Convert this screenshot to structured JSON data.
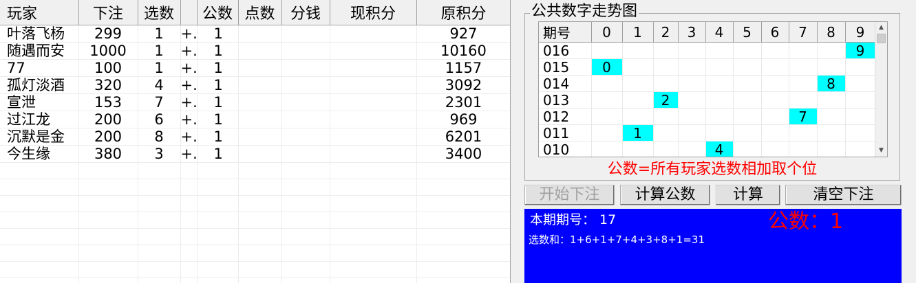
{
  "grid": {
    "columns": [
      "玩家",
      "下注",
      "选数",
      "",
      "公数",
      "点数",
      "分钱",
      "现积分",
      "原积分"
    ],
    "rows": [
      {
        "name": "叶落飞杨",
        "bet": "299",
        "sel": "1",
        "op": "+.",
        "pub": "1",
        "orig": "927"
      },
      {
        "name": "随遇而安",
        "bet": "1000",
        "sel": "1",
        "op": "+.",
        "pub": "1",
        "orig": "10160"
      },
      {
        "name": "77",
        "bet": "100",
        "sel": "1",
        "op": "+.",
        "pub": "1",
        "orig": "1157"
      },
      {
        "name": "孤灯淡酒",
        "bet": "320",
        "sel": "4",
        "op": "+.",
        "pub": "1",
        "orig": "3092"
      },
      {
        "name": "宣泄",
        "bet": "153",
        "sel": "7",
        "op": "+.",
        "pub": "1",
        "orig": "2301"
      },
      {
        "name": "过江龙",
        "bet": "200",
        "sel": "6",
        "op": "+.",
        "pub": "1",
        "orig": "969"
      },
      {
        "name": "沉默是金",
        "bet": "200",
        "sel": "8",
        "op": "+.",
        "pub": "1",
        "orig": "6201"
      },
      {
        "name": "今生缘",
        "bet": "380",
        "sel": "3",
        "op": "+.",
        "pub": "1",
        "orig": "3400"
      }
    ]
  },
  "trend": {
    "legend": "公共数字走势图",
    "columns": [
      "期号",
      "0",
      "1",
      "2",
      "3",
      "4",
      "5",
      "6",
      "7",
      "8",
      "9"
    ],
    "rows": [
      {
        "period": "016",
        "hit": 9
      },
      {
        "period": "015",
        "hit": 0
      },
      {
        "period": "014",
        "hit": 8
      },
      {
        "period": "013",
        "hit": 2
      },
      {
        "period": "012",
        "hit": 7
      },
      {
        "period": "011",
        "hit": 1
      },
      {
        "period": "010",
        "hit": 4
      }
    ],
    "rule": "公数=所有玩家选数相加取个位",
    "highlight_color": "#00ffff"
  },
  "buttons": {
    "start_bet": "开始下注",
    "calc_pub": "计算公数",
    "calc": "计算",
    "clear_bet": "清空下注"
  },
  "info": {
    "period_label": "本期期号：",
    "period_value": "17",
    "pub_label": "公数：",
    "pub_value": "1",
    "sum_text": "选数和：1+6+1+7+4+3+8+1=31",
    "bg_color": "#0000ff"
  },
  "icons": {
    "scroll_up": "scroll-up-arrow-icon",
    "scroll_down": "scroll-down-arrow-icon"
  }
}
